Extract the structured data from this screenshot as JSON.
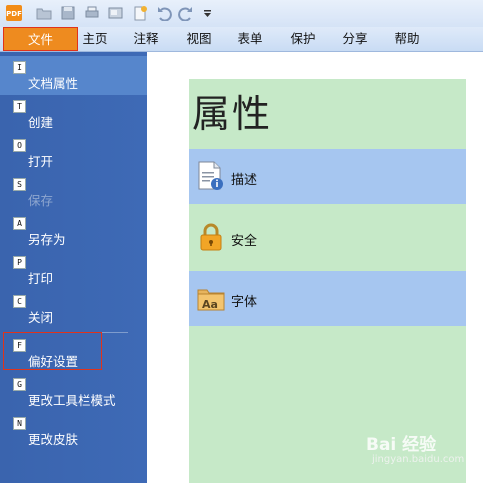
{
  "quick_access": {
    "app_icon_label": "PDF",
    "icons": [
      "open-folder-icon",
      "save-icon",
      "print-icon",
      "print-preview-icon",
      "new-document-icon",
      "undo-icon",
      "redo-icon",
      "customize-dropdown-icon"
    ]
  },
  "ribbon": {
    "tabs": [
      {
        "label": "文件",
        "active": true
      },
      {
        "label": "主页"
      },
      {
        "label": "注释"
      },
      {
        "label": "视图"
      },
      {
        "label": "表单"
      },
      {
        "label": "保护"
      },
      {
        "label": "分享"
      },
      {
        "label": "帮助"
      }
    ]
  },
  "file_menu": {
    "items": [
      {
        "key": "I",
        "label": "文档属性",
        "selected": true
      },
      {
        "key": "T",
        "label": "创建"
      },
      {
        "key": "O",
        "label": "打开"
      },
      {
        "key": "S",
        "label": "保存",
        "disabled": true
      },
      {
        "key": "A",
        "label": "另存为"
      },
      {
        "key": "P",
        "label": "打印"
      },
      {
        "key": "C",
        "label": "关闭"
      },
      {
        "key": "F",
        "label": "偏好设置",
        "highlighted": true
      },
      {
        "key": "G",
        "label": "更改工具栏模式"
      },
      {
        "key": "N",
        "label": "更改皮肤"
      }
    ]
  },
  "properties": {
    "title": "属性",
    "items": [
      {
        "label": "描述",
        "icon": "document-info-icon"
      },
      {
        "label": "安全",
        "icon": "lock-icon"
      },
      {
        "label": "字体",
        "icon": "font-folder-icon"
      }
    ]
  },
  "watermark": {
    "text": "Bai 经验",
    "sub": "jingyan.baidu.com"
  },
  "colors": {
    "menu_bg": "#3e6ab6",
    "file_tab": "#ee8b1f",
    "content_bg": "#c6e9c8",
    "row_blue": "#a6c6f0",
    "highlight_border": "#e0331b"
  }
}
